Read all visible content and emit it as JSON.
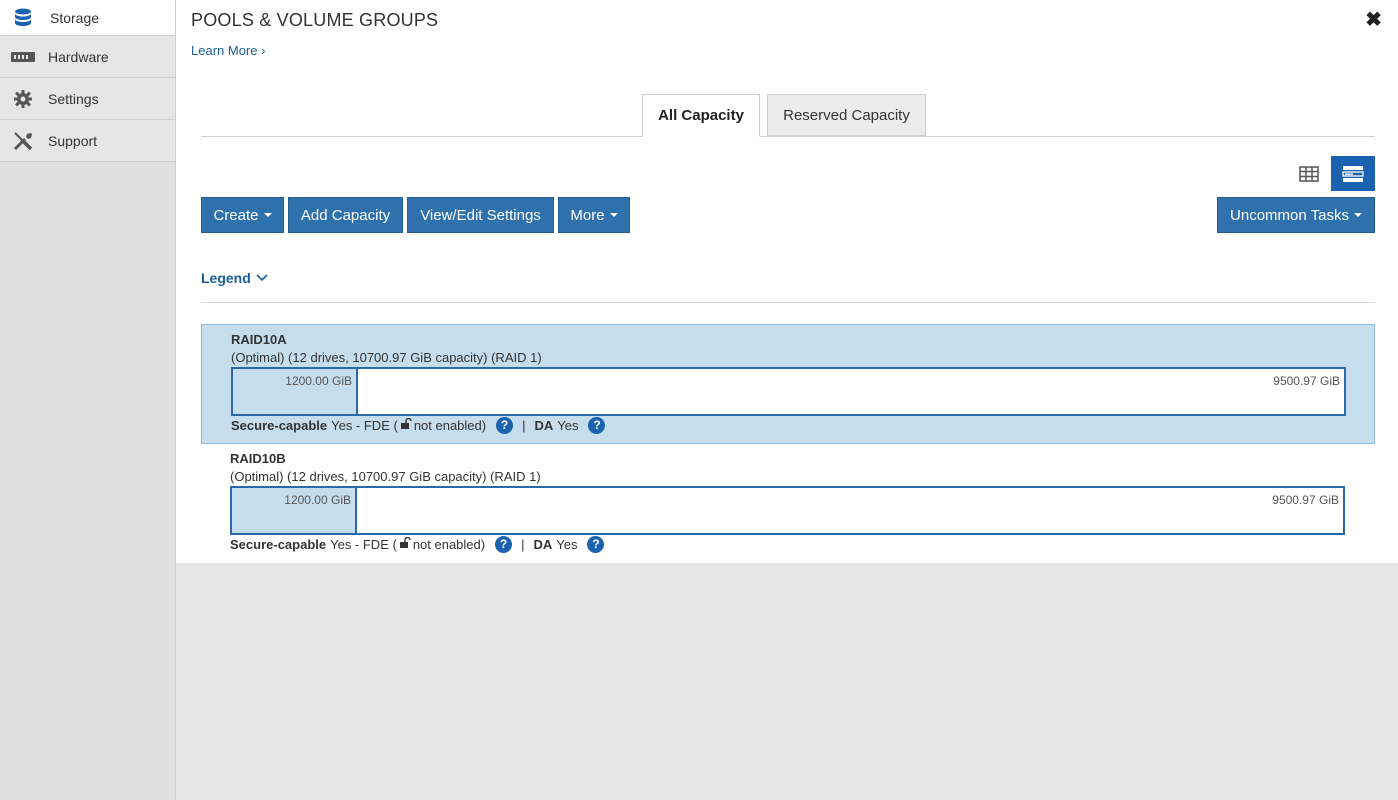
{
  "sidebar": {
    "items": [
      {
        "label": "Storage",
        "icon": "database-icon"
      },
      {
        "label": "Hardware",
        "icon": "server-icon"
      },
      {
        "label": "Settings",
        "icon": "gear-icon"
      },
      {
        "label": "Support",
        "icon": "tools-icon"
      }
    ]
  },
  "header": {
    "title": "POOLS & VOLUME GROUPS",
    "learn_more": "Learn More",
    "close_symbol": "✖"
  },
  "tabs": [
    {
      "label": "All Capacity",
      "active": true
    },
    {
      "label": "Reserved Capacity",
      "active": false
    }
  ],
  "toolbar": {
    "create_label": "Create",
    "add_capacity_label": "Add Capacity",
    "view_edit_label": "View/Edit Settings",
    "more_label": "More",
    "uncommon_label": "Uncommon Tasks"
  },
  "legend_label": "Legend",
  "pools": [
    {
      "name": "RAID10A",
      "status": "(Optimal) (12 drives, 10700.97 GiB capacity) (RAID 1)",
      "used": "1200.00 GiB",
      "free": "9500.97 GiB",
      "secure_label": "Secure-capable",
      "secure_value": "Yes - FDE (",
      "secure_tail": " not enabled)",
      "da_label": "DA",
      "da_value": "Yes",
      "selected": true
    },
    {
      "name": "RAID10B",
      "status": "(Optimal) (12 drives, 10700.97 GiB capacity) (RAID 1)",
      "used": "1200.00 GiB",
      "free": "9500.97 GiB",
      "secure_label": "Secure-capable",
      "secure_value": "Yes - FDE (",
      "secure_tail": " not enabled)",
      "da_label": "DA",
      "da_value": "Yes",
      "selected": false
    }
  ],
  "colors": {
    "accent": "#2f71ad",
    "selected_bg": "#c5ddec",
    "link": "#1a5e9a"
  }
}
